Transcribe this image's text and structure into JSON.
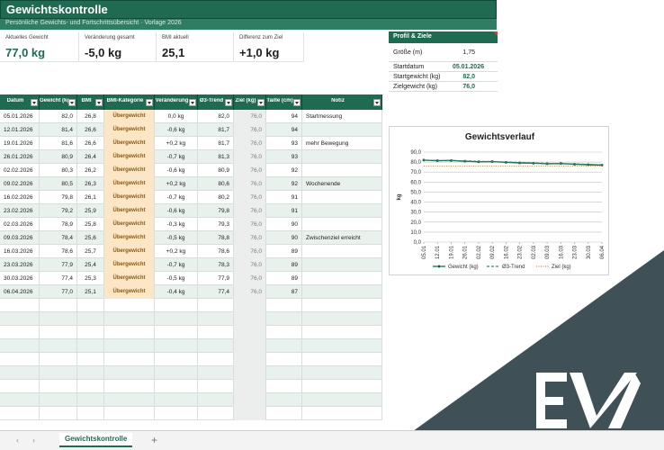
{
  "title": "Gewichtskontrolle",
  "subtitle": "Persönliche Gewichts- und Fortschrittsübersicht  ·  Vorlage 2026",
  "kpis": [
    {
      "label": "Aktuelles Gewicht",
      "value": "77,0 kg"
    },
    {
      "label": "Veränderung gesamt",
      "value": "-5,0 kg"
    },
    {
      "label": "BMI aktuell",
      "value": "25,1"
    },
    {
      "label": "Differenz zum Ziel",
      "value": "+1,0 kg"
    }
  ],
  "profile": {
    "heading": "Profil & Ziele",
    "rows": [
      {
        "key": "Größe (m)",
        "value": "1,75"
      },
      {
        "key": "Startdatum",
        "value": "05.01.2026"
      },
      {
        "key": "Startgewicht (kg)",
        "value": "82,0"
      },
      {
        "key": "Zielgewicht (kg)",
        "value": "76,0"
      }
    ]
  },
  "table": {
    "headers": [
      "Datum",
      "Gewicht (kg)",
      "BMI",
      "BMI-Kategorie",
      "Veränderung",
      "Ø3-Trend",
      "Ziel (kg)",
      "Taille (cm)",
      "Notiz"
    ],
    "rows": [
      [
        "05.01.2026",
        "82,0",
        "26,8",
        "Übergewicht",
        "0,0 kg",
        "82,0",
        "76,0",
        "94",
        "Startmessung"
      ],
      [
        "12.01.2026",
        "81,4",
        "26,6",
        "Übergewicht",
        "-0,6 kg",
        "81,7",
        "76,0",
        "94",
        ""
      ],
      [
        "19.01.2026",
        "81,6",
        "26,6",
        "Übergewicht",
        "+0,2 kg",
        "81,7",
        "76,0",
        "93",
        "mehr Bewegung"
      ],
      [
        "26.01.2026",
        "80,9",
        "26,4",
        "Übergewicht",
        "-0,7 kg",
        "81,3",
        "76,0",
        "93",
        ""
      ],
      [
        "02.02.2026",
        "80,3",
        "26,2",
        "Übergewicht",
        "-0,6 kg",
        "80,9",
        "76,0",
        "92",
        ""
      ],
      [
        "09.02.2026",
        "80,5",
        "26,3",
        "Übergewicht",
        "+0,2 kg",
        "80,6",
        "76,0",
        "92",
        "Wochenende"
      ],
      [
        "16.02.2026",
        "79,8",
        "26,1",
        "Übergewicht",
        "-0,7 kg",
        "80,2",
        "76,0",
        "91",
        ""
      ],
      [
        "23.02.2026",
        "79,2",
        "25,9",
        "Übergewicht",
        "-0,6 kg",
        "79,8",
        "76,0",
        "91",
        ""
      ],
      [
        "02.03.2026",
        "78,9",
        "25,8",
        "Übergewicht",
        "-0,3 kg",
        "79,3",
        "76,0",
        "90",
        ""
      ],
      [
        "09.03.2026",
        "78,4",
        "25,6",
        "Übergewicht",
        "-0,5 kg",
        "78,8",
        "76,0",
        "90",
        "Zwischenziel erreicht"
      ],
      [
        "16.03.2026",
        "78,6",
        "25,7",
        "Übergewicht",
        "+0,2 kg",
        "78,6",
        "76,0",
        "89",
        ""
      ],
      [
        "23.03.2026",
        "77,9",
        "25,4",
        "Übergewicht",
        "-0,7 kg",
        "78,3",
        "76,0",
        "89",
        ""
      ],
      [
        "30.03.2026",
        "77,4",
        "25,3",
        "Übergewicht",
        "-0,5 kg",
        "77,9",
        "76,0",
        "89",
        ""
      ],
      [
        "06.04.2026",
        "77,0",
        "25,1",
        "Übergewicht",
        "-0,4 kg",
        "77,4",
        "76,0",
        "87",
        ""
      ]
    ]
  },
  "chart_data": {
    "type": "line",
    "title": "Gewichtsverlauf",
    "ylabel": "kg",
    "xlabel": "",
    "ylim": [
      0,
      90
    ],
    "yticks": [
      "0,0",
      "10,0",
      "20,0",
      "30,0",
      "40,0",
      "50,0",
      "60,0",
      "70,0",
      "80,0",
      "90,0"
    ],
    "categories": [
      "05.01",
      "12.01",
      "19.01",
      "26.01",
      "02.02",
      "09.02",
      "16.02",
      "23.02",
      "02.03",
      "09.03",
      "16.03",
      "23.03",
      "30.03",
      "06.04"
    ],
    "series": [
      {
        "name": "Gewicht (kg)",
        "values": [
          82.0,
          81.4,
          81.6,
          80.9,
          80.3,
          80.5,
          79.8,
          79.2,
          78.9,
          78.4,
          78.6,
          77.9,
          77.4,
          77.0
        ],
        "color": "#1e6b52",
        "style": "solid-markers"
      },
      {
        "name": "Ø3-Trend",
        "values": [
          82.0,
          81.7,
          81.7,
          81.3,
          80.9,
          80.6,
          80.2,
          79.8,
          79.3,
          78.8,
          78.6,
          78.3,
          77.9,
          77.4
        ],
        "color": "#2e8b6a",
        "style": "dashed"
      },
      {
        "name": "Ziel (kg)",
        "values": [
          76,
          76,
          76,
          76,
          76,
          76,
          76,
          76,
          76,
          76,
          76,
          76,
          76,
          76
        ],
        "color": "#d08a3a",
        "style": "dotted"
      }
    ],
    "grid": true,
    "legend": "bottom"
  },
  "sheet_tabs": {
    "active": "Gewichtskontrolle",
    "prev": "‹",
    "next": "›",
    "add": "+"
  },
  "colors": {
    "accent": "#1e6b52",
    "category_fill": "#fce6c6",
    "watermark": "#3f5157"
  },
  "icons": {
    "filter": "dropdown-arrow-icon",
    "logo": "ex-logo-icon"
  }
}
